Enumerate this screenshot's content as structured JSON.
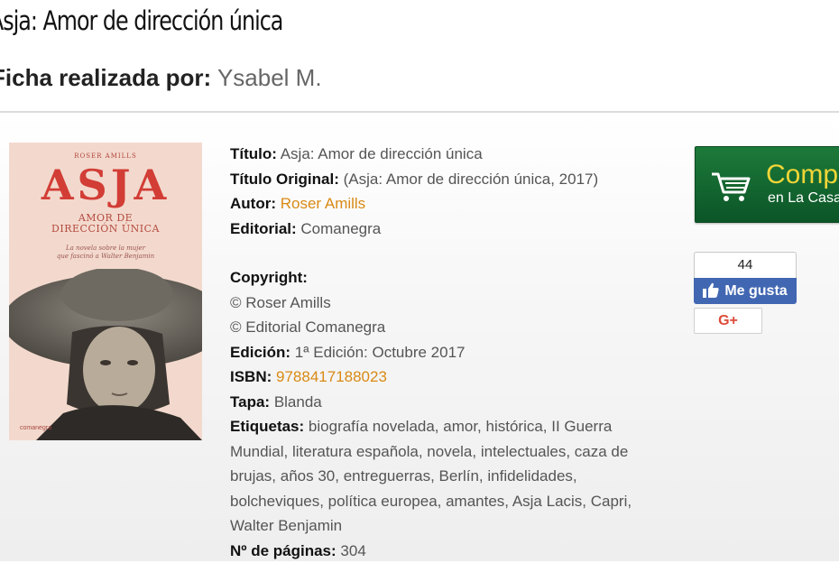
{
  "page": {
    "title": "Asja: Amor de dirección única",
    "byline_label": "Ficha realizada por:",
    "byline_value": "Ysabel M."
  },
  "cover": {
    "author": "ROSER AMILLS",
    "title": "ASJA",
    "subtitle_line1": "AMOR DE",
    "subtitle_line2": "DIRECCIÓN ÚNICA",
    "tagline_line1": "La novela sobre la mujer",
    "tagline_line2": "que fascinó a Walter Benjamin",
    "publisher": "comanegra"
  },
  "details": {
    "titulo_label": "Título:",
    "titulo": "Asja: Amor de dirección única",
    "titulo_original_label": "Título Original:",
    "titulo_original": "(Asja: Amor de dirección única, 2017)",
    "autor_label": "Autor:",
    "autor": "Roser Amills",
    "editorial_label": "Editorial:",
    "editorial": "Comanegra",
    "copyright_label": "Copyright:",
    "copyright_1": "© Roser Amills",
    "copyright_2": "© Editorial Comanegra",
    "edicion_label": "Edición:",
    "edicion": "1ª Edición: Octubre 2017",
    "isbn_label": "ISBN:",
    "isbn": "9788417188023",
    "tapa_label": "Tapa:",
    "tapa": "Blanda",
    "etiquetas_label": "Etiquetas:",
    "etiquetas": "biografía novelada, amor, histórica, II Guerra Mundial, literatura española, novela, intelectuales, caza de brujas, años 30, entreguerras, Berlín, infidelidades, bolcheviques, política europea, amantes, Asja Lacis, Capri, Walter Benjamin",
    "paginas_label": "Nº de páginas:",
    "paginas": "304"
  },
  "buy_button": {
    "main": "Comp",
    "sub_prefix": "en",
    "sub": "La Casa",
    "icon": "shopping-cart-icon"
  },
  "social": {
    "like_count": "44",
    "like_label": "Me gusta",
    "gplus_label": "G+",
    "like_icon": "thumbs-up-icon"
  },
  "colors": {
    "link": "#d98a15",
    "buy_green": "#1d7a3a",
    "buy_text": "#f1d538",
    "facebook": "#4267b2",
    "gplus": "#dd4b39"
  }
}
